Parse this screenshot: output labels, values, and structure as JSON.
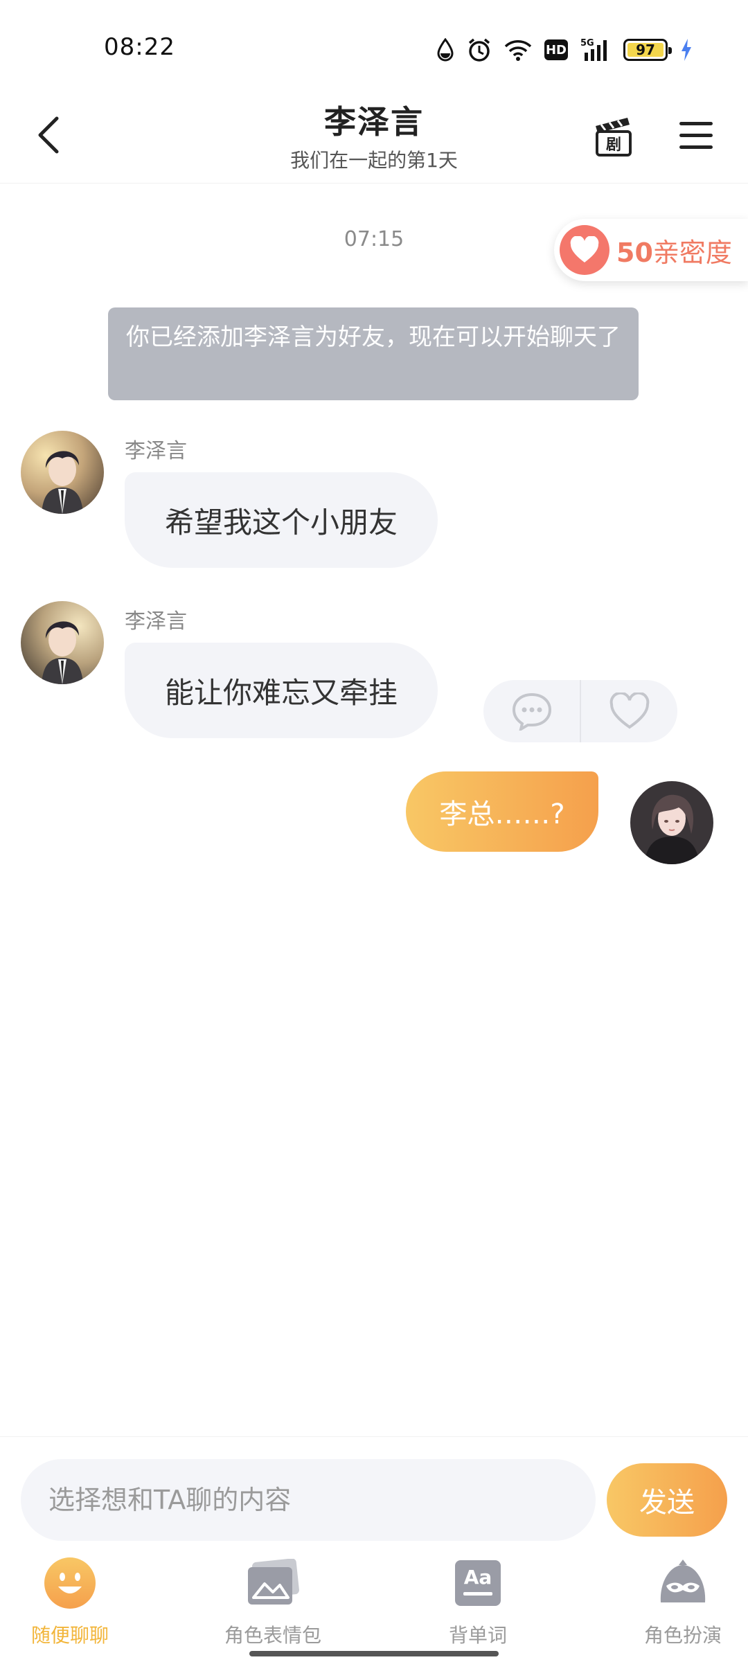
{
  "status_bar": {
    "time": "08:22",
    "battery": "97",
    "network": "5G"
  },
  "header": {
    "title": "李泽言",
    "subtitle": "我们在一起的第1天",
    "drama_icon_label": "剧"
  },
  "chat": {
    "timestamp": "07:15",
    "intimacy": {
      "value": "50",
      "label": "亲密度"
    },
    "system_message": "你已经添加李泽言为好友，现在可以开始聊天了",
    "messages": [
      {
        "sender": "李泽言",
        "text": "希望我这个小朋友"
      },
      {
        "sender": "李泽言",
        "text": "能让你难忘又牵挂"
      },
      {
        "sender": "me",
        "text": "李总……?"
      }
    ]
  },
  "input": {
    "placeholder": "选择想和TA聊的内容",
    "send_label": "发送"
  },
  "tabs": [
    {
      "label": "随便聊聊",
      "icon": "smile-face-icon",
      "active": true
    },
    {
      "label": "角色表情包",
      "icon": "sticker-image-icon",
      "active": false
    },
    {
      "label": "背单词",
      "icon": "vocabulary-aa-icon",
      "active": false
    },
    {
      "label": "角色扮演",
      "icon": "mask-roleplay-icon",
      "active": false
    }
  ],
  "colors": {
    "accent": "#F5A04C",
    "accent_light": "#F8C765",
    "heart": "#F4776B",
    "bubble_in": "#F3F4F8",
    "system_msg": "#B5B8C0"
  }
}
